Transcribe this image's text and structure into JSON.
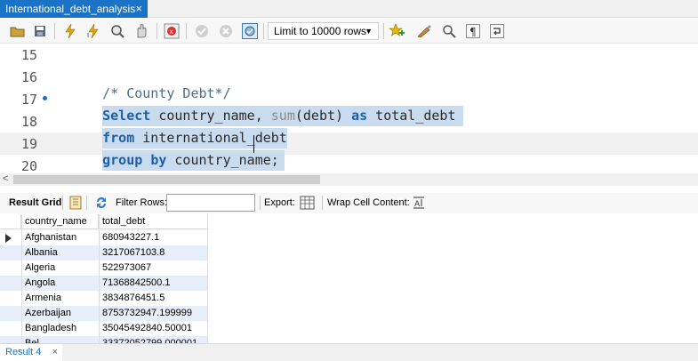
{
  "tab": {
    "title": "International_debt_analysis",
    "close": "×"
  },
  "toolbar": {
    "limit_label": "Limit to 10000 rows",
    "icons": [
      "open-folder-icon",
      "save-icon",
      "execute-icon",
      "execute-current-icon",
      "explain-icon",
      "stop-icon",
      "toggle-error-icon",
      "commit-icon",
      "rollback-icon",
      "autocommit-icon",
      "favorite-icon",
      "beautify-icon",
      "find-icon",
      "invisible-chars-icon",
      "wrap-icon"
    ]
  },
  "editor": {
    "line_numbers": [
      "15",
      "16",
      "17",
      "18",
      "19",
      "20"
    ],
    "comment": "/* County Debt*/",
    "line17": {
      "kw1": "Select",
      "rest1": " country_name, ",
      "fn": "sum",
      "rest2": "(debt) ",
      "kw2": "as",
      "rest3": " total_debt"
    },
    "line18": {
      "kw": "from",
      "rest": " international_debt"
    },
    "line19": {
      "kw1": "group",
      "kw2": "by",
      "rest": " country_name;"
    }
  },
  "result_toolbar": {
    "result_grid_label": "Result Grid",
    "filter_label": "Filter Rows:",
    "export_label": "Export:",
    "wrap_label": "Wrap Cell Content:"
  },
  "grid": {
    "columns": [
      "country_name",
      "total_debt"
    ],
    "rows": [
      [
        "Afghanistan",
        "680943227.1"
      ],
      [
        "Albania",
        "3217067103.8"
      ],
      [
        "Algeria",
        "522973067"
      ],
      [
        "Angola",
        "71368842500.1"
      ],
      [
        "Armenia",
        "3834876451.5"
      ],
      [
        "Azerbaijan",
        "8753732947.199999"
      ],
      [
        "Bangladesh",
        "35045492840.50001"
      ],
      [
        "Bel...",
        "33372052799.000001"
      ]
    ]
  },
  "bottom_tab": {
    "label": "Result 4",
    "close": "×"
  }
}
